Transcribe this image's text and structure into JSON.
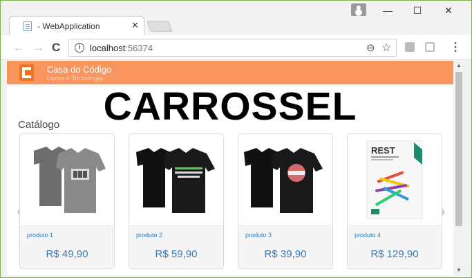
{
  "browser": {
    "tab_title": "- WebApplication",
    "tab_close": "✕",
    "url_host": "localhost",
    "url_port": ":56374",
    "controls": {
      "minimize": "—",
      "maximize": "☐",
      "close": "✕"
    },
    "nav": {
      "back": "←",
      "forward": "→",
      "reload": "C"
    },
    "icons": {
      "info": "i",
      "zoom": "⊖",
      "star": "☆",
      "menu": "⋮"
    }
  },
  "site": {
    "brand_name": "Casa do Código",
    "brand_tagline": "Livros e Tecnologia",
    "brand_color": "#f9965f"
  },
  "page": {
    "overlay_title": "CARROSSEL",
    "section_title": "Catálogo"
  },
  "products": [
    {
      "name": "produto 1",
      "price": "R$ 49,90",
      "image": "grey-tshirt"
    },
    {
      "name": "produto 2",
      "price": "R$ 59,90",
      "image": "black-tshirt-code"
    },
    {
      "name": "produto 3",
      "price": "R$ 39,90",
      "image": "black-tshirt-graphic"
    },
    {
      "name": "produto 4",
      "price": "R$ 129,90",
      "image": "rest-book-cover",
      "book_title": "REST"
    }
  ],
  "carousel": {
    "prev": "❮",
    "next": "❯"
  }
}
